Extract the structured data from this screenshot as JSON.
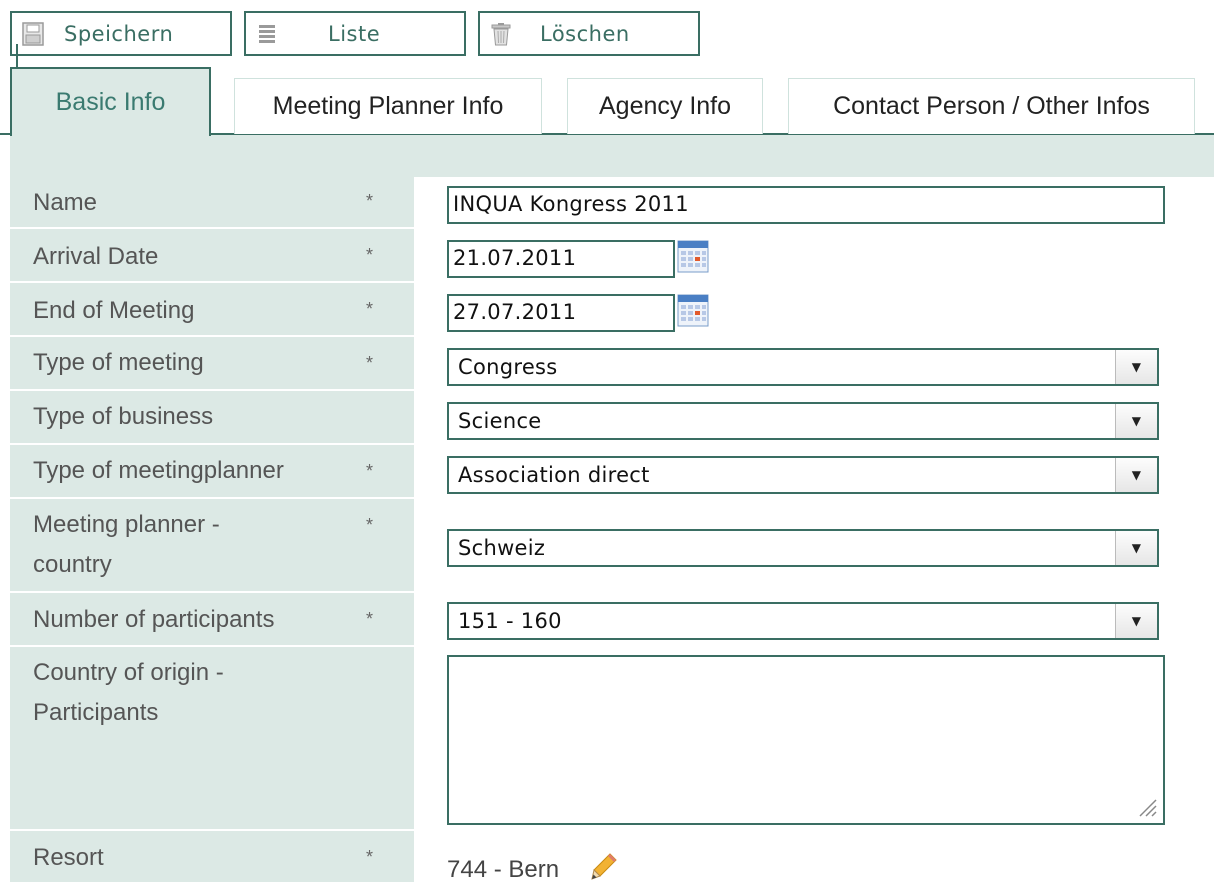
{
  "toolbar": {
    "save_label": "Speichern",
    "list_label": "Liste",
    "delete_label": "Löschen",
    "save_icon": "floppy-disk-icon",
    "list_icon": "list-icon",
    "delete_icon": "trash-icon"
  },
  "tabs": [
    {
      "label": "Basic Info",
      "active": true
    },
    {
      "label": "Meeting Planner Info",
      "active": false
    },
    {
      "label": "Agency Info",
      "active": false
    },
    {
      "label": "Contact Person / Other Infos",
      "active": false
    }
  ],
  "form": {
    "required_mark": "*",
    "name": {
      "label": "Name",
      "value": "INQUA Kongress 2011"
    },
    "arrival_date": {
      "label": "Arrival Date",
      "value": "21.07.2011"
    },
    "end_of_meeting": {
      "label": "End of Meeting",
      "value": "27.07.2011"
    },
    "type_of_meeting": {
      "label": "Type of meeting",
      "value": "Congress"
    },
    "type_of_business": {
      "label": "Type of business",
      "value": "Science"
    },
    "type_of_meetingplanner": {
      "label": "Type of meetingplanner",
      "value": "Association direct"
    },
    "meeting_planner_country": {
      "label_line1": "Meeting planner -",
      "label_line2": "country",
      "value": "Schweiz"
    },
    "number_of_participants": {
      "label": "Number of participants",
      "value": "151 - 160"
    },
    "country_of_origin": {
      "label_line1": "Country of origin -",
      "label_line2": "Participants",
      "value": ""
    },
    "resort": {
      "label": "Resort",
      "value": "744 - Bern"
    }
  },
  "colors": {
    "accent": "#3a6e63",
    "panel_bg": "#dce9e5",
    "active_tab_text": "#3a7a70"
  }
}
